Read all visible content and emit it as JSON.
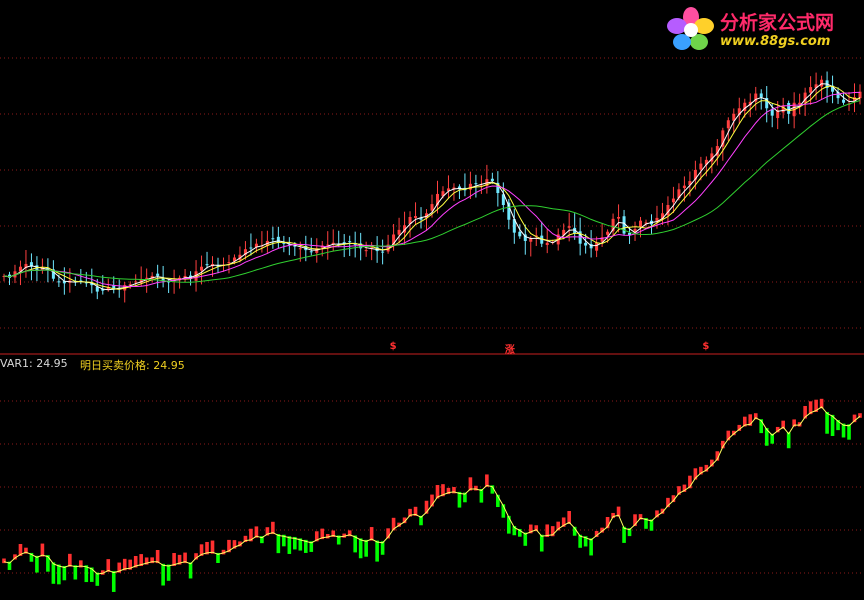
{
  "watermark": {
    "title": "分析家公式网",
    "url": "www.88gs.com"
  },
  "indicator_labels": {
    "var1": "VAR1: 24.95",
    "price": "明日买卖价格: 24.95"
  },
  "signals": [
    {
      "text": "$",
      "bar": 71
    },
    {
      "text": "涨",
      "bar": 92
    },
    {
      "text": "$",
      "bar": 128
    }
  ],
  "colors": {
    "up": "#ff3030",
    "down": "#00ff00",
    "candle_up": "#ff4040",
    "candle_down": "#70e8ff",
    "ma_white": "#ffffff",
    "ma_yellow": "#ffff40",
    "ma_magenta": "#ff40ff",
    "ma_green": "#30d030",
    "grid": "#8b1a1a",
    "separator": "#c82020",
    "indicator_line": "#ffff60"
  },
  "chart_data": [
    {
      "type": "candlestick",
      "series": [
        {
          "name": "close",
          "values": [
            50,
            48,
            55,
            60,
            63,
            60,
            56,
            59,
            57,
            47,
            44,
            42,
            45,
            43,
            44,
            43,
            40,
            33,
            34,
            38,
            35,
            37,
            40,
            41,
            44,
            46,
            48,
            50,
            50,
            45,
            44,
            46,
            48,
            50,
            47,
            55,
            60,
            62,
            63,
            60,
            62,
            65,
            70,
            73,
            79,
            80,
            85,
            83,
            88,
            90,
            86,
            85,
            83,
            82,
            80,
            78,
            76,
            80,
            83,
            84,
            86,
            84,
            85,
            87,
            84,
            80,
            78,
            81,
            77,
            76,
            84,
            95,
            100,
            105,
            114,
            115,
            111,
            118,
            128,
            139,
            142,
            145,
            146,
            144,
            143,
            150,
            150,
            148,
            155,
            153,
            140,
            127,
            111,
            97,
            93,
            88,
            91,
            94,
            85,
            86,
            87,
            95,
            100,
            104,
            96,
            85,
            83,
            80,
            86,
            92,
            98,
            112,
            114,
            96,
            94,
            101,
            110,
            108,
            106,
            113,
            118,
            127,
            134,
            144,
            148,
            153,
            165,
            172,
            176,
            183,
            191,
            208,
            219,
            226,
            232,
            238,
            239,
            248,
            244,
            232,
            224,
            230,
            235,
            226,
            238,
            238,
            249,
            255,
            258,
            263,
            254,
            250,
            243,
            238,
            237,
            244,
            250
          ]
        }
      ],
      "ylim": [
        0,
        300
      ]
    },
    {
      "type": "bar",
      "series": [
        {
          "name": "VAR1",
          "values": [
            50,
            48,
            55,
            60,
            63,
            60,
            56,
            59,
            57,
            47,
            44,
            42,
            45,
            43,
            44,
            43,
            40,
            33,
            34,
            38,
            35,
            37,
            40,
            41,
            44,
            46,
            48,
            50,
            50,
            45,
            44,
            46,
            48,
            50,
            47,
            55,
            60,
            62,
            63,
            60,
            62,
            65,
            70,
            73,
            79,
            80,
            85,
            83,
            88,
            90,
            86,
            85,
            83,
            82,
            80,
            78,
            76,
            80,
            83,
            84,
            86,
            84,
            85,
            87,
            84,
            80,
            78,
            81,
            77,
            76,
            84,
            95,
            100,
            105,
            114,
            115,
            111,
            118,
            128,
            139,
            142,
            145,
            146,
            144,
            143,
            150,
            150,
            148,
            155,
            153,
            140,
            127,
            111,
            97,
            93,
            88,
            91,
            94,
            85,
            86,
            87,
            95,
            100,
            104,
            96,
            85,
            83,
            80,
            86,
            92,
            98,
            112,
            114,
            96,
            94,
            101,
            110,
            108,
            106,
            113,
            118,
            127,
            134,
            144,
            148,
            153,
            165,
            172,
            176,
            183,
            191,
            208,
            219,
            226,
            232,
            238,
            239,
            248,
            244,
            232,
            224,
            230,
            235,
            226,
            238,
            238,
            249,
            255,
            258,
            263,
            254,
            250,
            243,
            238,
            237,
            244,
            250
          ]
        }
      ],
      "ylim": [
        0,
        300
      ]
    }
  ]
}
